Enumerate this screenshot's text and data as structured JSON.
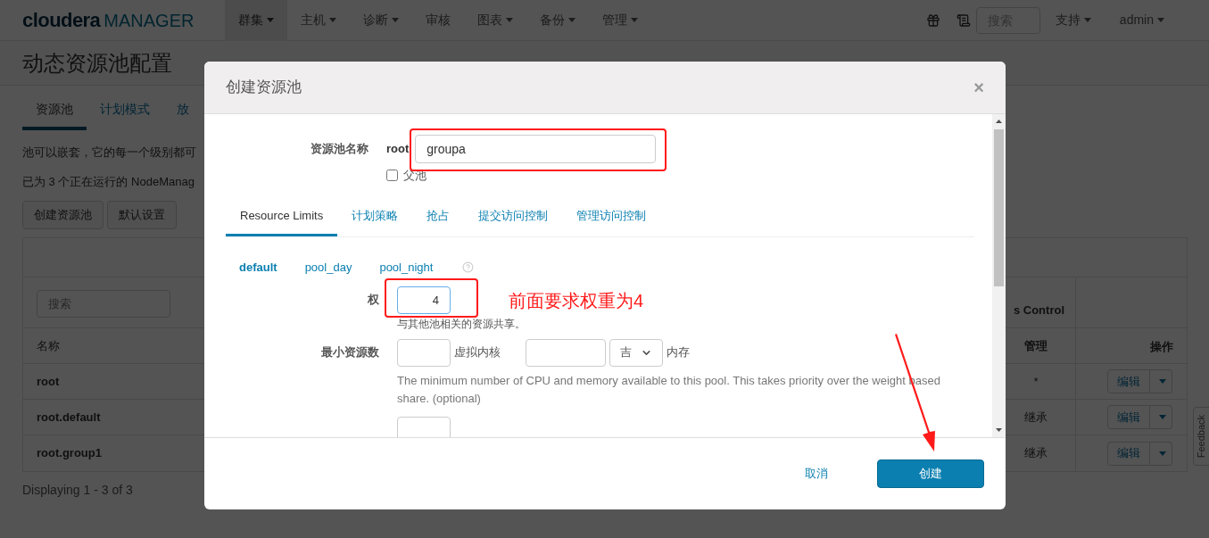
{
  "navbar": {
    "logo": {
      "brand": "cloudera",
      "product": "MANAGER"
    },
    "menu": [
      {
        "label": "群集",
        "dropdown": true,
        "selected": true
      },
      {
        "label": "主机",
        "dropdown": true,
        "selected": false
      },
      {
        "label": "诊断",
        "dropdown": true,
        "selected": false
      },
      {
        "label": "审核",
        "dropdown": false,
        "selected": false
      },
      {
        "label": "图表",
        "dropdown": true,
        "selected": false
      },
      {
        "label": "备份",
        "dropdown": true,
        "selected": false
      },
      {
        "label": "管理",
        "dropdown": true,
        "selected": false
      }
    ],
    "search": {
      "placeholder": "搜索"
    },
    "right_menus": [
      "支持",
      "admin"
    ]
  },
  "page": {
    "title": "动态资源池配置",
    "tabs": [
      {
        "label": "资源池",
        "selected": true
      },
      {
        "label": "计划模式",
        "selected": false
      },
      {
        "label": "放",
        "selected": false
      }
    ],
    "description": "池可以嵌套，它的每一个级别都可",
    "status": "已为 3 个正在运行的 NodeManag",
    "buttons": [
      "创建资源池",
      "默认设置"
    ],
    "table": {
      "search": {
        "placeholder": "搜索"
      },
      "group_header": "s Control",
      "columns": [
        "名称",
        "管理",
        "操作"
      ],
      "rows": [
        {
          "name": "root",
          "admin": "*",
          "action": "编辑"
        },
        {
          "name": "root.default",
          "admin": "继承",
          "action": "编辑"
        },
        {
          "name": "root.group1",
          "admin": "继承",
          "action": "编辑"
        }
      ],
      "footer": "Displaying 1 - 3 of 3"
    },
    "feedback": "Feedback"
  },
  "modal": {
    "title": "创建资源池",
    "close": "×",
    "name": {
      "label": "资源池名称",
      "prefix": "root",
      "value": "groupa"
    },
    "parent": {
      "label": "父池",
      "checked": false
    },
    "tabs": [
      {
        "label": "Resource Limits",
        "selected": true
      },
      {
        "label": "计划策略",
        "selected": false
      },
      {
        "label": "抢占",
        "selected": false
      },
      {
        "label": "提交访问控制",
        "selected": false
      },
      {
        "label": "管理访问控制",
        "selected": false
      }
    ],
    "schedules": [
      {
        "label": "default",
        "selected": true
      },
      {
        "label": "pool_day",
        "selected": false
      },
      {
        "label": "pool_night",
        "selected": false
      }
    ],
    "weight": {
      "label": "权",
      "value": "4",
      "help": "与其他池相关的资源共享。"
    },
    "min_resources": {
      "label": "最小资源数",
      "vcores_unit": "虚拟内核",
      "memory_unit": "吉",
      "memory_label": "内存",
      "help": "The minimum number of CPU and memory available to this pool. This takes priority over the weight based share. (optional)"
    },
    "cancel": "取消",
    "create": "创建"
  },
  "annotation": {
    "note": "前面要求权重为4"
  }
}
